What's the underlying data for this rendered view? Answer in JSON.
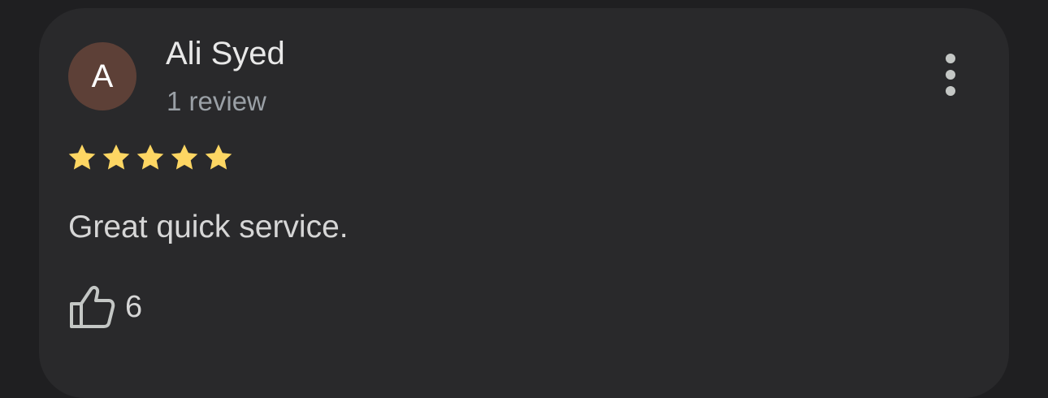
{
  "review": {
    "author_initial": "A",
    "author_name": "Ali Syed",
    "author_review_count": "1 review",
    "rating": 5,
    "rating_max": 5,
    "text": "Great quick service.",
    "like_count": "6"
  },
  "colors": {
    "background": "#1f1f21",
    "card": "#29292b",
    "avatar": "#5d4037",
    "star": "#fdd663",
    "text_primary": "#e8e8e8",
    "text_secondary": "#9aa0a6"
  },
  "icons": {
    "more": "more-vert-icon",
    "star": "star-icon",
    "like": "thumb-up-icon"
  }
}
